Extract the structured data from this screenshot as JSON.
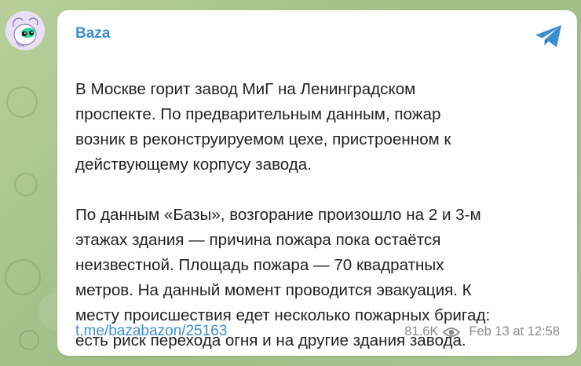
{
  "channel": {
    "name": "Baza",
    "avatar_icon": "baza-character-avatar-icon"
  },
  "message": {
    "paragraph1": "В Москве горит завод МиГ на Ленинградском\nпроспекте. По предварительным данным, пожар\nвозник в реконструируемом цехе, пристроенном к\nдействующему корпусу завода.",
    "paragraph2": "По данным «Базы», возгорание произошло на 2 и 3-м\nэтажах здания — причина пожара пока остаётся\nнеизвестной. Площадь пожара — 70 квадратных\nметров. На данный момент проводится эвакуация. К\nместу происшествия едет несколько пожарных бригад:\nесть риск перехода огня и на другие здания завода.",
    "link": "t.me/bazabazon/25163",
    "views": "81.6K",
    "date": "Feb 13 at 12:58"
  },
  "icons": {
    "share": "telegram-share-icon",
    "views": "eye-icon"
  },
  "colors": {
    "accent": "#3a8fd1",
    "background": "#a9c191",
    "bubble": "#ffffff",
    "meta_text": "#8a8a8a"
  }
}
